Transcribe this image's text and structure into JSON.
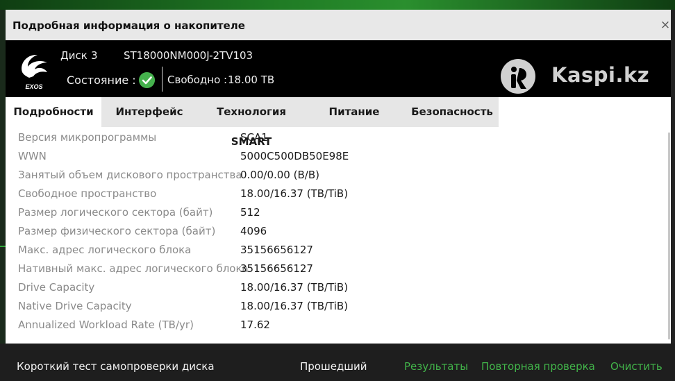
{
  "dialog": {
    "title": "Подробная информация о накопителе",
    "close_label": "×"
  },
  "disk": {
    "label": "Диск",
    "number": "3",
    "model": "ST18000NM000J-2TV103",
    "logo_text": "EXOS",
    "state_label": "Состояние :",
    "free_label": "Свободно :",
    "free_value": "18.00 TB"
  },
  "watermark": {
    "text": "Kaspi.kz"
  },
  "tabs": [
    {
      "label": "Подробности",
      "active": true
    },
    {
      "label": "Интерфейс",
      "active": false
    },
    {
      "label": "Технология SMART",
      "active": false
    },
    {
      "label": "Питание",
      "active": false
    },
    {
      "label": "Безопасность",
      "active": false
    }
  ],
  "details": [
    {
      "label": "Версия микропрограммы",
      "value": "SCA1"
    },
    {
      "label": "WWN",
      "value": "5000C500DB50E98E"
    },
    {
      "label": "Занятый объем дискового пространства",
      "value": "0.00/0.00 (B/B)"
    },
    {
      "label": "Свободное пространство",
      "value": "18.00/16.37 (TB/TiB)"
    },
    {
      "label": "Размер логического сектора (байт)",
      "value": "512"
    },
    {
      "label": "Размер физического сектора (байт)",
      "value": "4096"
    },
    {
      "label": "Макс. адрес логического блока",
      "value": "35156656127"
    },
    {
      "label": "Нативный макс. адрес логического блока",
      "value": "35156656127"
    },
    {
      "label": "Drive Capacity",
      "value": "18.00/16.37 (TB/TiB)"
    },
    {
      "label": "Native Drive Capacity",
      "value": "18.00/16.37 (TB/TiB)"
    },
    {
      "label": "Annualized Workload Rate (TB/yr)",
      "value": "17.62"
    }
  ],
  "self_test": {
    "label": "Короткий тест самопроверки диска",
    "status": "Прошедший",
    "results_link": "Результаты",
    "retest_link": "Повторная проверка",
    "clear_link": "Очистить"
  },
  "colors": {
    "accent_green": "#42b54a",
    "header_bg": "#000000",
    "tab_bar_bg": "#e6e6e6",
    "label_gray": "#8a8a8a"
  }
}
